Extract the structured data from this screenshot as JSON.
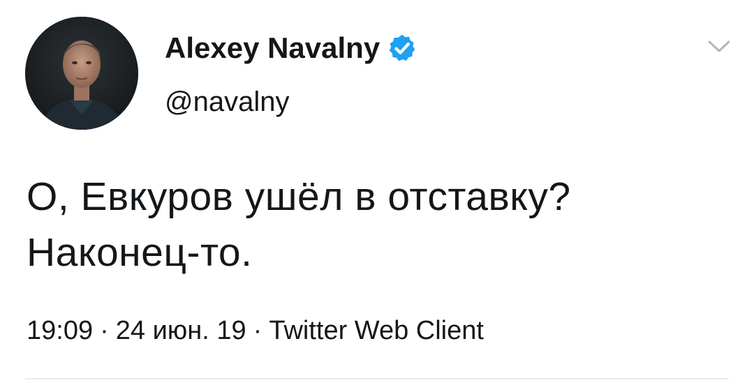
{
  "author": {
    "display_name": "Alexey Navalny",
    "handle": "@navalny",
    "verified": true,
    "avatar_icon": "profile-photo"
  },
  "tweet": {
    "text_line_1": "О, Евкуров ушёл в отставку?",
    "text_line_2": "Наконец-то."
  },
  "meta": {
    "time": "19:09",
    "date": "24 июн. 19",
    "separator": "·",
    "client": "Twitter Web Client"
  },
  "icons": {
    "verified": "verified-badge-icon",
    "more": "chevron-down-icon"
  },
  "colors": {
    "verified_blue": "#1da1f2",
    "text": "#14171a",
    "chevron": "#aab8c2",
    "divider": "#e6ecf0"
  }
}
